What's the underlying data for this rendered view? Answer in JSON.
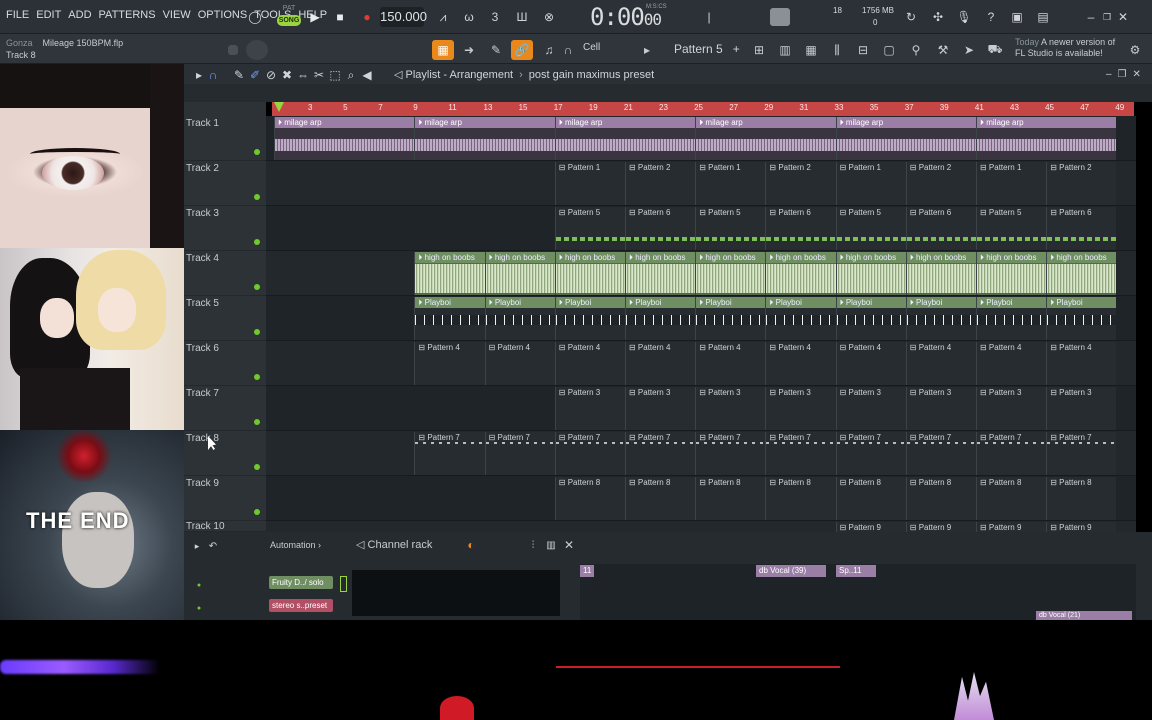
{
  "topbar": {
    "menus": [
      "FILE",
      "EDIT",
      "ADD",
      "PATTERNS",
      "VIEW",
      "OPTIONS",
      "TOOLS",
      "HELP"
    ],
    "mode_pat": "PAT",
    "mode_song": "SONG",
    "bpm": "150.000",
    "clock_main": "0:00",
    "clock_sub": "00",
    "clock_unit": "M:S:CS",
    "cpu_value": "18",
    "memory": "1756 MB",
    "voices": "0"
  },
  "toolbar2": {
    "user": "Gonza",
    "project": "Mileage 150BPM.flp",
    "hint": "Track 8",
    "snap": "Cell",
    "pattern": "Pattern 5",
    "news_date": "Today",
    "news_text_1": "A newer version of",
    "news_text_2": "FL Studio is available!"
  },
  "video": {
    "end_text": "THE END"
  },
  "playlist": {
    "title": "Playlist - Arrangement",
    "preset": "post gain maximus preset",
    "ruler": [
      "3",
      "5",
      "7",
      "9",
      "11",
      "13",
      "15",
      "17",
      "19",
      "21",
      "23",
      "25",
      "27",
      "29",
      "31",
      "33",
      "35",
      "37",
      "39",
      "41",
      "43",
      "45",
      "47",
      "49"
    ],
    "tracks": [
      "Track 1",
      "Track 2",
      "Track 3",
      "Track 4",
      "Track 5",
      "Track 6",
      "Track 7",
      "Track 8",
      "Track 9",
      "Track 10"
    ],
    "clip_names": {
      "arp": "milage arp",
      "p1": "Pattern 1",
      "p2": "Pattern 2",
      "p3": "Pattern 3",
      "p4": "Pattern 4",
      "p5": "Pattern 5",
      "p6": "Pattern 6",
      "p7": "Pattern 7",
      "p8": "Pattern 8",
      "p9": "Pattern 9",
      "hob": "high on boobs",
      "pb": "Playboi"
    }
  },
  "bottom": {
    "automation": "Automation",
    "channel_rack": "Channel rack",
    "chan1": "Fruity D../ solo",
    "chan2": "stereo s..preset",
    "mini_clip_1": "11",
    "mini_clip_2": "db Vocal (39)",
    "mini_clip_3": "Sp..11",
    "mini_clip_4": "db Vocal (21)"
  },
  "colors": {
    "ruler": "#c64545",
    "song_mode": "#9bd441",
    "arp_clip": "#9a7ea6",
    "audio_clip": "#6f8f62"
  }
}
